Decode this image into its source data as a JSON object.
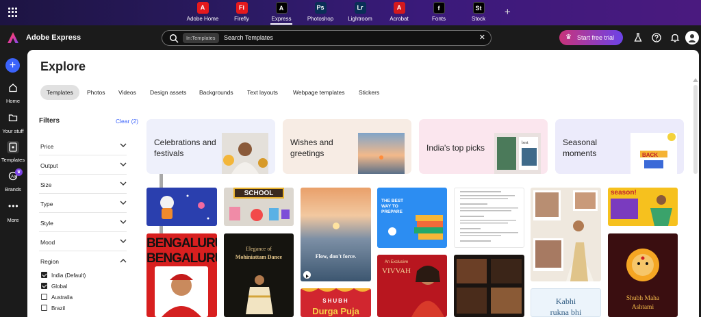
{
  "app_switcher": {
    "apps": [
      {
        "label": "Adobe Home",
        "glyph": "A",
        "color": "#e5191d"
      },
      {
        "label": "Firefly",
        "glyph": "Fi",
        "color": "#e5191d"
      },
      {
        "label": "Express",
        "glyph": "A",
        "color": "#000000"
      },
      {
        "label": "Photoshop",
        "glyph": "Ps",
        "color": "#0a2f57"
      },
      {
        "label": "Lightroom",
        "glyph": "Lr",
        "color": "#0a2f57"
      },
      {
        "label": "Acrobat",
        "glyph": "A",
        "color": "#d4191d"
      },
      {
        "label": "Fonts",
        "glyph": "f",
        "color": "#000000"
      },
      {
        "label": "Stock",
        "glyph": "St",
        "color": "#000000"
      }
    ],
    "add_label": "+"
  },
  "header": {
    "brand": "Adobe Express",
    "search_chip": "In:Templates",
    "search_text": "Search Templates",
    "clear_glyph": "✕",
    "trial_label": "Start free trial"
  },
  "leftnav": {
    "fab": "+",
    "items": [
      "Home",
      "Your stuff",
      "Templates",
      "Brands",
      "More"
    ]
  },
  "main": {
    "title": "Explore",
    "tabs": [
      "Templates",
      "Photos",
      "Videos",
      "Design assets",
      "Backgrounds",
      "Text layouts",
      "Webpage templates",
      "Stickers"
    ]
  },
  "filters": {
    "title": "Filters",
    "clear": "Clear (2)",
    "rows": [
      "Price",
      "Output",
      "Size",
      "Type",
      "Style",
      "Mood",
      "Region"
    ],
    "region_options": [
      {
        "label": "India (Default)",
        "checked": true
      },
      {
        "label": "Global",
        "checked": true
      },
      {
        "label": "Australia",
        "checked": false
      },
      {
        "label": "Brazil",
        "checked": false
      }
    ]
  },
  "categories": [
    {
      "line1": "Celebrations and",
      "line2": "festivals",
      "bg": "#eef0fb"
    },
    {
      "line1": "Wishes and",
      "line2": "greetings",
      "bg": "#f7ece4"
    },
    {
      "line1": "India's top picks",
      "line2": "",
      "bg": "#fbe6ee"
    },
    {
      "line1": "Seasonal",
      "line2": "moments",
      "bg": "#ecebfb"
    }
  ],
  "templates": {
    "school": "SCHOOL",
    "bengaluru": "BENGALURU",
    "mohiniattam_1": "Elegance of",
    "mohiniattam_2": "Mohiniattam Dance",
    "flow": "Flow, don't force.",
    "vivvah_1": "An Exclusive",
    "vivvah_2": "VIVVAH",
    "exams": "THE BEST WAY TO PREPARE",
    "season": "season!",
    "shubh_1": "SHUBH",
    "shubh_2": "Durga Puja",
    "kabhi_1": "Kabhi",
    "kabhi_2": "rukna bhi",
    "ashtami_1": "Shubh Maha",
    "ashtami_2": "Ashtami"
  }
}
